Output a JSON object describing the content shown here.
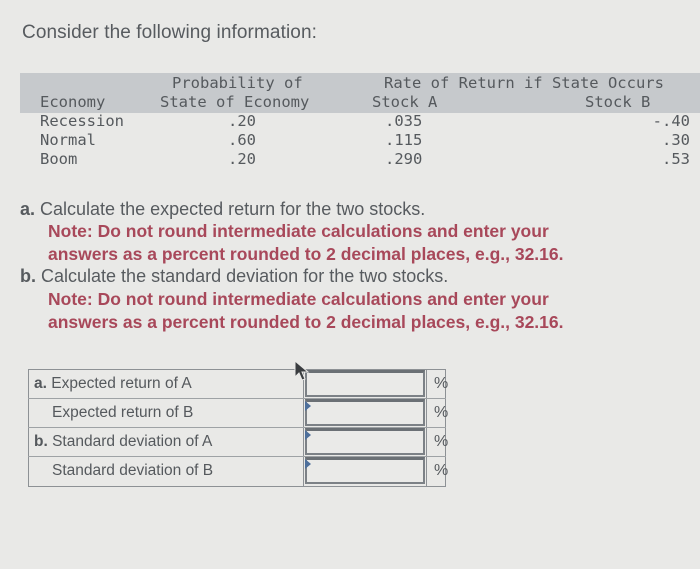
{
  "intro": "Consider the following information:",
  "table": {
    "headers": {
      "economy": "Economy",
      "probability_line1": "Probability of",
      "probability_line2": "State of Economy",
      "rate_of_return": "Rate of Return if State Occurs",
      "stock_a": "Stock A",
      "stock_b": "Stock B"
    },
    "rows": [
      {
        "economy": "Recession",
        "probability": ".20",
        "stock_a": ".035",
        "stock_b": "-.40"
      },
      {
        "economy": "Normal",
        "probability": ".60",
        "stock_a": ".115",
        "stock_b": ".30"
      },
      {
        "economy": "Boom",
        "probability": ".20",
        "stock_a": ".290",
        "stock_b": ".53"
      }
    ]
  },
  "questions": {
    "a": {
      "label": "a.",
      "text": "Calculate the expected return for the two stocks.",
      "note_line1": "Note: Do not round intermediate calculations and enter your",
      "note_line2": "answers as a percent rounded to 2 decimal places, e.g., 32.16."
    },
    "b": {
      "label": "b.",
      "text": "Calculate the standard deviation for the two stocks.",
      "note_line1": "Note: Do not round intermediate calculations and enter your",
      "note_line2": "answers as a percent rounded to 2 decimal places, e.g., 32.16."
    }
  },
  "answers": [
    {
      "prefix": "a.",
      "label": "Expected return of A",
      "value": "",
      "unit": "%"
    },
    {
      "prefix": "",
      "label": "Expected return of B",
      "value": "",
      "unit": "%"
    },
    {
      "prefix": "b.",
      "label": "Standard deviation of A",
      "value": "",
      "unit": "%"
    },
    {
      "prefix": "",
      "label": "Standard deviation of B",
      "value": "",
      "unit": "%"
    }
  ]
}
